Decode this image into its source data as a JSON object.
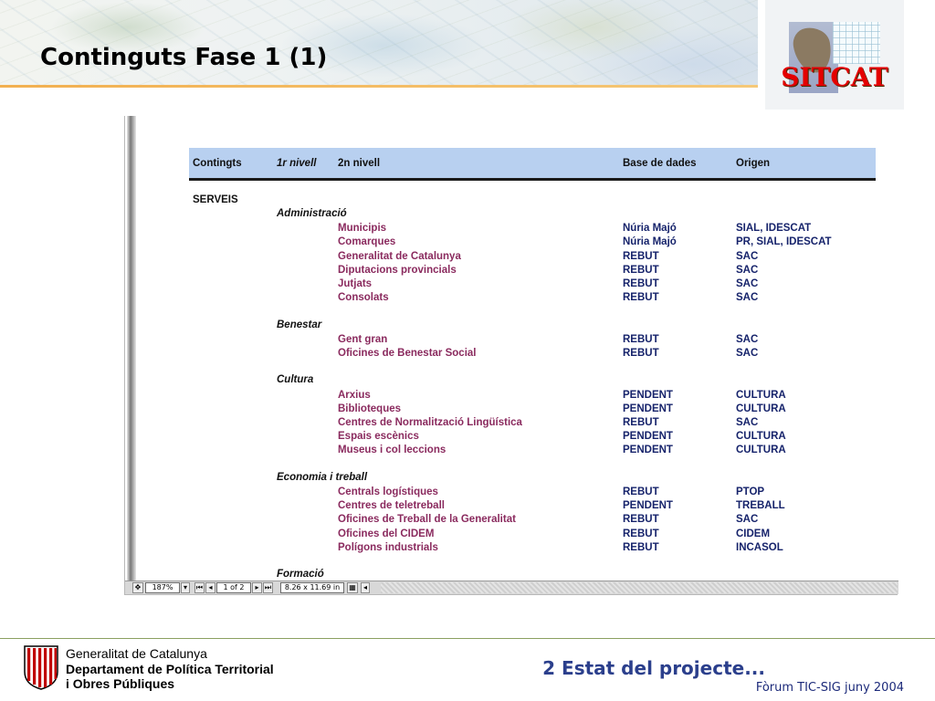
{
  "slide": {
    "title": "Continguts Fase 1 (1)",
    "logo_text": "SITCAT"
  },
  "table": {
    "headers": {
      "contingut": "Contingts",
      "nivell1": "1r nivell",
      "nivell2": "2n nivell",
      "base_dades": "Base de dades",
      "origen": "Origen"
    },
    "section": "SERVEIS",
    "groups": [
      {
        "name": "Administració",
        "rows": [
          [
            "Municipis",
            "Núria Majó",
            "SIAL, IDESCAT"
          ],
          [
            "Comarques",
            "Núria Majó",
            "PR, SIAL, IDESCAT"
          ],
          [
            "Generalitat de Catalunya",
            "REBUT",
            "SAC"
          ],
          [
            "Diputacions provincials",
            "REBUT",
            "SAC"
          ],
          [
            "Jutjats",
            "REBUT",
            "SAC"
          ],
          [
            "Consolats",
            "REBUT",
            "SAC"
          ]
        ]
      },
      {
        "name": "Benestar",
        "rows": [
          [
            "Gent gran",
            "REBUT",
            "SAC"
          ],
          [
            "Oficines de Benestar Social",
            "REBUT",
            "SAC"
          ]
        ]
      },
      {
        "name": "Cultura",
        "rows": [
          [
            "Arxius",
            "PENDENT",
            "CULTURA"
          ],
          [
            "Biblioteques",
            "PENDENT",
            "CULTURA"
          ],
          [
            "Centres de Normalització Lingüística",
            "REBUT",
            "SAC"
          ],
          [
            "Espais escènics",
            "PENDENT",
            "CULTURA"
          ],
          [
            "Museus i col   leccions",
            "PENDENT",
            "CULTURA"
          ]
        ]
      },
      {
        "name": "Economia i treball",
        "rows": [
          [
            "Centrals logístiques",
            "REBUT",
            "PTOP"
          ],
          [
            "Centres de teletreball",
            "PENDENT",
            "TREBALL"
          ],
          [
            "Oficines de Treball de la Generalitat",
            "REBUT",
            "SAC"
          ],
          [
            "Oficines del CIDEM",
            "REBUT",
            "CIDEM"
          ],
          [
            "Polígons industrials",
            "REBUT",
            "INCASOL"
          ]
        ]
      },
      {
        "name": "Formació",
        "rows": []
      }
    ]
  },
  "viewer": {
    "zoom": "187%",
    "page_indicator": "1 of 2",
    "page_size": "8.26 x 11.69 in"
  },
  "footer": {
    "org_line1": "Generalitat de Catalunya",
    "org_line2": "Departament de Política Territorial",
    "org_line3": "i Obres Públiques",
    "section": "2 Estat del projecte...",
    "event": "Fòrum TIC-SIG juny 2004"
  },
  "colors": {
    "title_rule": "#f2b050",
    "table_header_bg": "#b8d0f0",
    "item_name": "#8a2a5e",
    "item_values": "#16236b",
    "logo_red": "#e40000",
    "footer_blue": "#2b3f8c"
  }
}
